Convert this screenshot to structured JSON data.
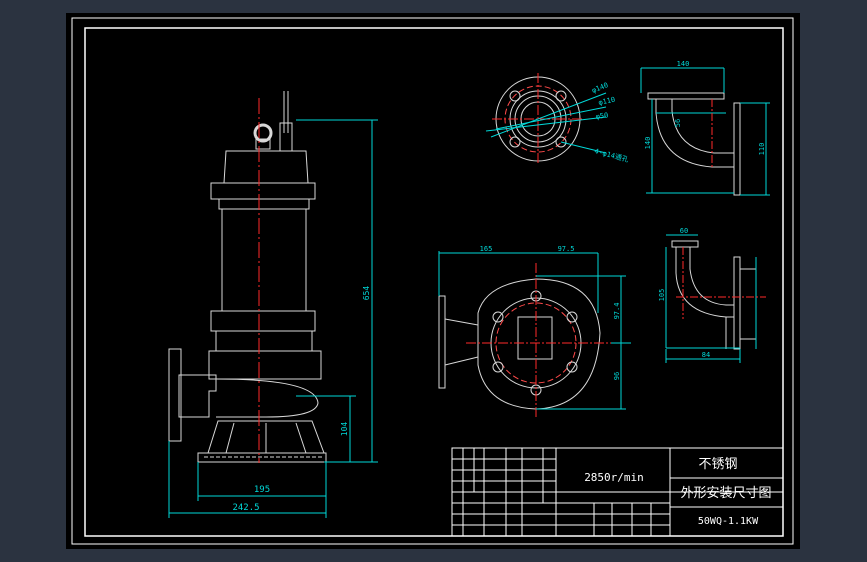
{
  "drawing": {
    "speed_text": "2850r/min",
    "material": "不锈钢",
    "drawing_title": "外形安装尺寸图",
    "model": "50WQ-1.1KW",
    "dimensions": {
      "overall_height": "654",
      "lower_height": "104",
      "base_width": "195",
      "overall_width": "242.5",
      "top_width": "165",
      "offset_a": "97.5",
      "offset_b": "97.4",
      "side_h": "96",
      "elbow_top": "140",
      "elbow_h": "140",
      "elbow_side": "110",
      "elbow_r": "56",
      "flange_d1": "φ140",
      "flange_d2": "φ110",
      "flange_d3": "φ50",
      "flange_holes": "4-φ14通孔",
      "small_top": "60",
      "small_h": "105",
      "small_bottom": "84"
    }
  },
  "colors": {
    "frame": "#ffffff",
    "dimension": "#00d8d8",
    "center": "#ff2a2a",
    "part": "#d8d8d8",
    "hidden": "#ff4a4a",
    "title_text": "#ffffff"
  }
}
